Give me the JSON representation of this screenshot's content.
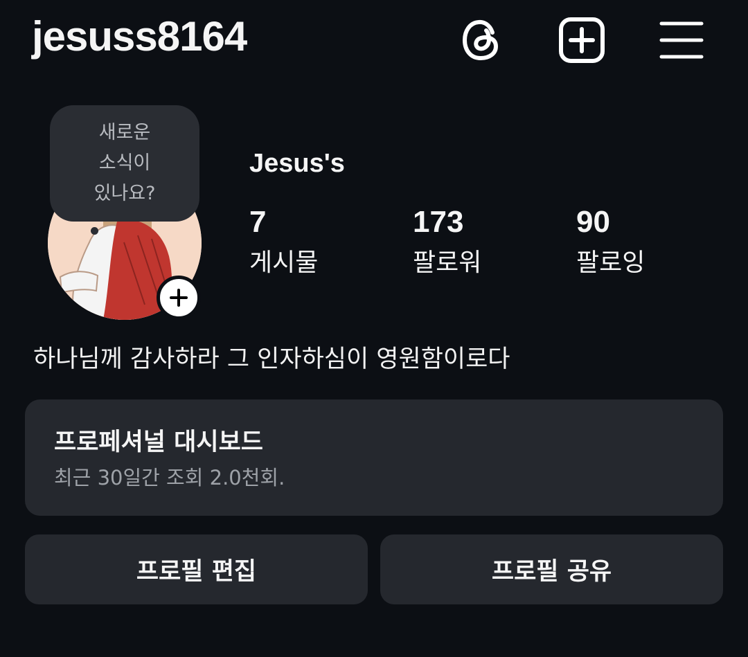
{
  "header": {
    "username": "jesuss8164",
    "icons": [
      "threads-icon",
      "add-post-icon",
      "menu-icon"
    ]
  },
  "profile": {
    "note_bubble": {
      "line1": "새로운",
      "line2": "소식이",
      "line3": "있나요?"
    },
    "display_name": "Jesus's",
    "stats": [
      {
        "value": "7",
        "label": "게시물"
      },
      {
        "value": "173",
        "label": "팔로워"
      },
      {
        "value": "90",
        "label": "팔로잉"
      }
    ],
    "bio": "하나님께 감사하라 그 인자하심이 영원함이로다"
  },
  "dashboard": {
    "title": "프로페셔널 대시보드",
    "subtitle": "최근 30일간 조회 2.0천회."
  },
  "buttons": {
    "edit_profile": "프로필 편집",
    "share_profile": "프로필 공유"
  },
  "colors": {
    "background": "#0c0f14",
    "card": "#25282e",
    "text": "#f5f5f5",
    "muted": "#9ea2a8"
  }
}
